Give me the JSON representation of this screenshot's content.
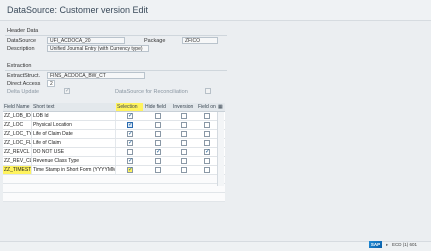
{
  "window": {
    "title": "DataSource: Customer version Edit"
  },
  "header_data": {
    "section_title": "Header Data",
    "datasource_label": "DataSource",
    "datasource_value": "UFI_ACDOCA_20",
    "package_label": "Package",
    "package_value": "ZFICO",
    "description_label": "Description",
    "description_value": "Unified Journal Entry (with Currency type)"
  },
  "extraction": {
    "section_title": "Extraction",
    "extractstruct_label": "ExtractStruct.",
    "extractstruct_value": "FINS_ACDOCA_BW_CT",
    "direct_access_label": "Direct Access",
    "direct_access_value": "2",
    "delta_update_label": "Delta Update",
    "datasource_reconciliation_label": "DataSource for Reconciliation"
  },
  "table": {
    "columns": [
      "Field Name",
      "Short text",
      "Selection",
      "Hide field",
      "Inversion",
      "Field only..."
    ],
    "rows": [
      {
        "field": "ZZ_LOB_ID",
        "text": "LOB Id"
      },
      {
        "field": "ZZ_LOC",
        "text": "Physical Location"
      },
      {
        "field": "ZZ_LOC_TY",
        "text": "Life of Claim Date"
      },
      {
        "field": "ZZ_LOC_FL",
        "text": "Life of Claim"
      },
      {
        "field": "ZZ_REVCL",
        "text": "DO NOT USE"
      },
      {
        "field": "ZZ_REV_CL",
        "text": "Revenue Class Type"
      },
      {
        "field": "ZZ_TIMEST",
        "text": "Time Stamp in Short Form (YYYYMMDD..."
      }
    ]
  },
  "status": {
    "system": "ECD (1) 601"
  }
}
